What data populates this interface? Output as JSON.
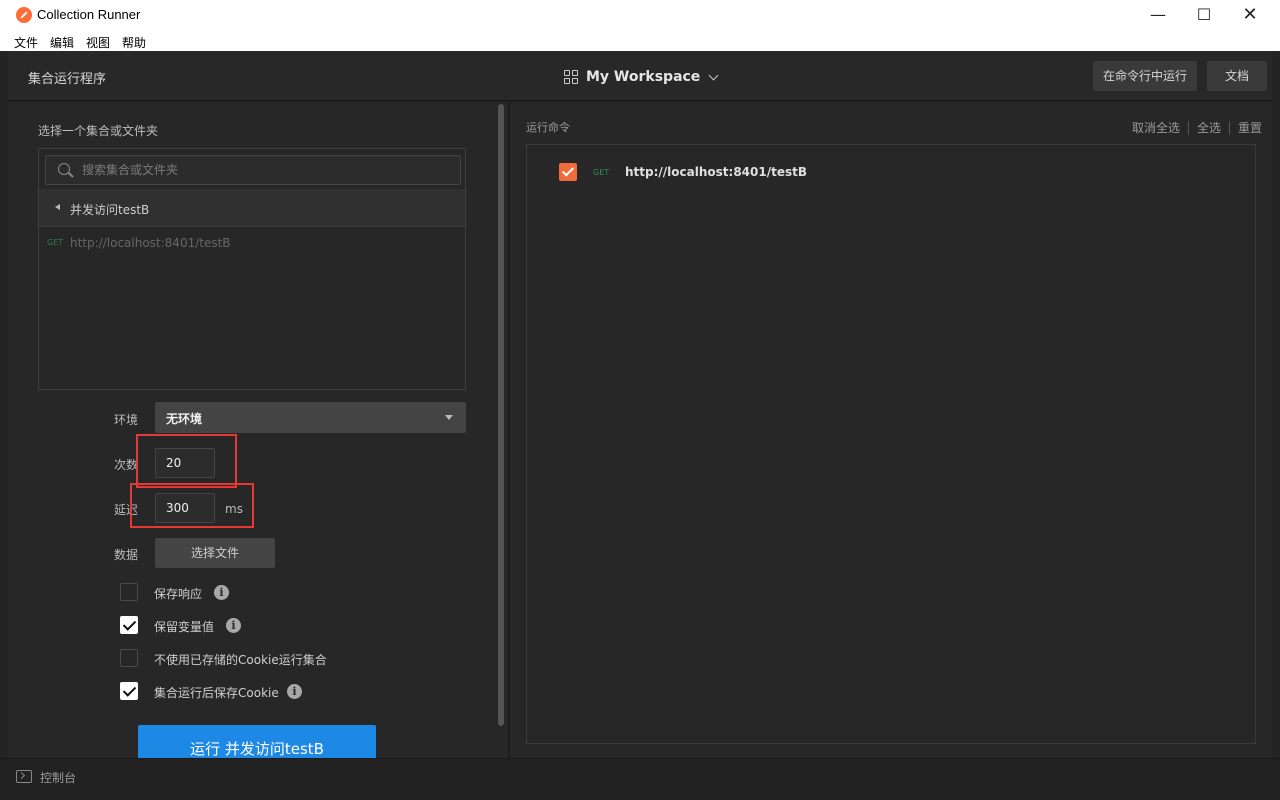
{
  "window": {
    "title": "Collection Runner",
    "controls": {
      "minimize": "—",
      "maximize": "☐",
      "close": "✕"
    }
  },
  "menu": [
    "文件",
    "编辑",
    "视图",
    "帮助"
  ],
  "header": {
    "title": "集合运行程序",
    "workspace": "My Workspace",
    "run_in_cli": "在命令行中运行",
    "docs": "文档"
  },
  "left": {
    "choose_label": "选择一个集合或文件夹",
    "search_placeholder": "搜索集合或文件夹",
    "folder": "并发访问testB",
    "request": {
      "method": "GET",
      "url": "http://localhost:8401/testB"
    },
    "env_label": "环境",
    "env_value": "无环境",
    "iterations_label": "次数",
    "iterations_value": "20",
    "delay_label": "延迟",
    "delay_value": "300",
    "delay_unit": "ms",
    "data_label": "数据",
    "select_file": "选择文件",
    "options": [
      {
        "label": "保存响应",
        "checked": false,
        "info": true
      },
      {
        "label": "保留变量值",
        "checked": true,
        "info": true
      },
      {
        "label": "不使用已存储的Cookie运行集合",
        "checked": false,
        "info": false
      },
      {
        "label": "集合运行后保存Cookie",
        "checked": true,
        "info": true
      }
    ],
    "run_button": "运行 并发访问testB"
  },
  "right": {
    "title": "运行命令",
    "deselect_all": "取消全选",
    "select_all": "全选",
    "reset": "重置",
    "items": [
      {
        "checked": true,
        "method": "GET",
        "url": "http://localhost:8401/testB"
      }
    ]
  },
  "status": {
    "console": "控制台"
  },
  "colors": {
    "accent_blue": "#1e88e5",
    "orange": "#f26b3a",
    "highlight_red": "#e53935"
  }
}
